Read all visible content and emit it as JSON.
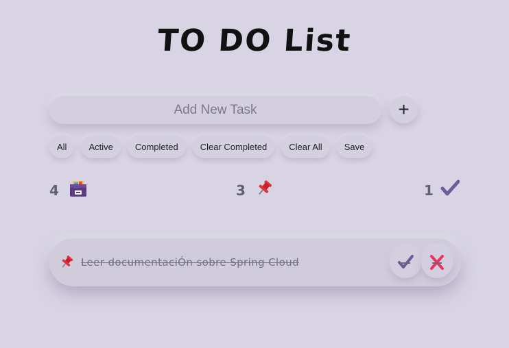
{
  "app": {
    "title": "TO DO List"
  },
  "input": {
    "placeholder": "Add New Task",
    "value": "",
    "add_label": "+"
  },
  "filters": [
    "All",
    "Active",
    "Completed",
    "Clear Completed",
    "Clear All",
    "Save"
  ],
  "stats": {
    "total": {
      "count": "4",
      "icon": "archive-box-icon"
    },
    "active": {
      "count": "3",
      "icon": "pushpin-icon"
    },
    "completed": {
      "count": "1",
      "icon": "checkmark-icon"
    }
  },
  "tasks": [
    {
      "text": "Leer documentaciÓn sobre Spring Cloud",
      "completed": true,
      "icon": "pushpin-icon"
    }
  ],
  "colors": {
    "background": "#d8d4e3",
    "check": "#6b5b9a",
    "delete": "#e8345f",
    "pin": "#e0303b",
    "archive_box": "#5b3a80"
  }
}
